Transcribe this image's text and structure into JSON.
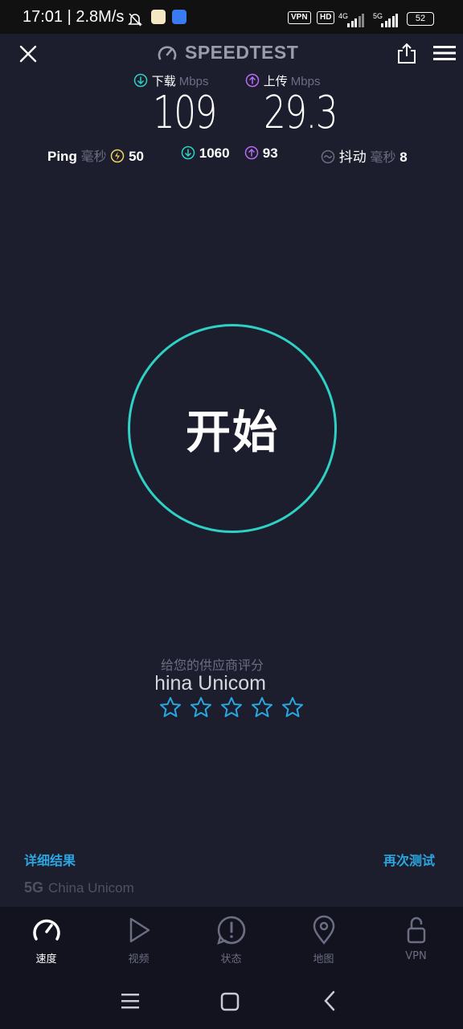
{
  "status_bar": {
    "time": "17:01",
    "speed": "2.8M/s",
    "vpn": "VPN",
    "hd": "HD",
    "net1": "4G",
    "net2": "5G",
    "battery": "52"
  },
  "header": {
    "title": "SPEEDTEST"
  },
  "download": {
    "label": "下载",
    "unit": "Mbps",
    "value": "109"
  },
  "upload": {
    "label": "上传",
    "unit": "Mbps",
    "value": "29.3"
  },
  "ping": {
    "label": "Ping",
    "unit": "毫秒",
    "idle": "50",
    "download": "1060",
    "upload": "93"
  },
  "jitter": {
    "label": "抖动",
    "unit": "毫秒",
    "value": "8"
  },
  "start_button": {
    "label": "开始"
  },
  "rating": {
    "prompt": "给您的供应商评分",
    "provider": "China Unicom",
    "stars_total": 5
  },
  "links": {
    "details": "详细结果",
    "retest": "再次测试"
  },
  "network": {
    "type": "5G",
    "provider": "China Unicom"
  },
  "tabs": [
    {
      "label": "速度",
      "icon": "speedometer-icon",
      "active": true
    },
    {
      "label": "视频",
      "icon": "play-icon",
      "active": false
    },
    {
      "label": "状态",
      "icon": "alert-icon",
      "active": false
    },
    {
      "label": "地图",
      "icon": "map-pin-icon",
      "active": false
    },
    {
      "label": "VPN",
      "icon": "lock-open-icon",
      "active": false
    }
  ],
  "colors": {
    "background": "#1c1e2e",
    "accent_teal": "#2fd1c4",
    "download": "#2fd1c4",
    "upload": "#b66bf2",
    "ping_idle": "#f2d45c",
    "link_blue": "#2aa6e0"
  }
}
